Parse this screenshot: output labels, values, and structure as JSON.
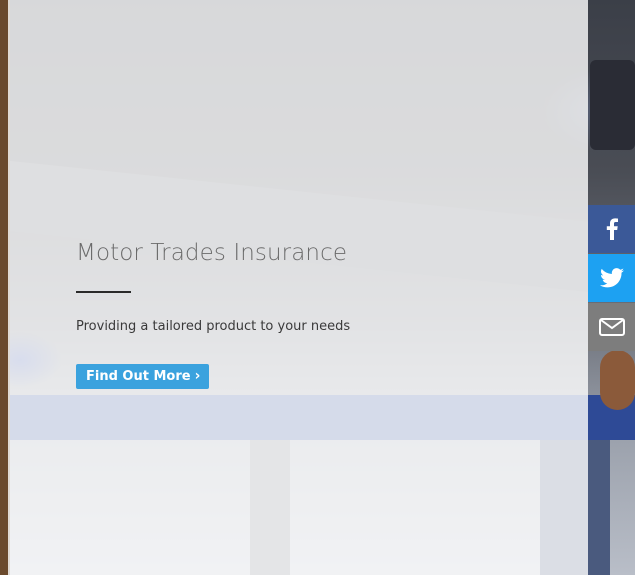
{
  "hero": {
    "title": "Motor Trades Insurance",
    "subtitle": "Providing a tailored product to your needs",
    "cta_label": "Find Out More",
    "cta_icon": "chevron-right-icon",
    "cta_color": "#3aa2de"
  },
  "social": {
    "items": [
      {
        "name": "facebook",
        "icon": "facebook-icon",
        "color": "#3b5998"
      },
      {
        "name": "twitter",
        "icon": "twitter-icon",
        "color": "#1da1f2"
      },
      {
        "name": "email",
        "icon": "envelope-icon",
        "color": "#7d7d7d"
      }
    ]
  }
}
